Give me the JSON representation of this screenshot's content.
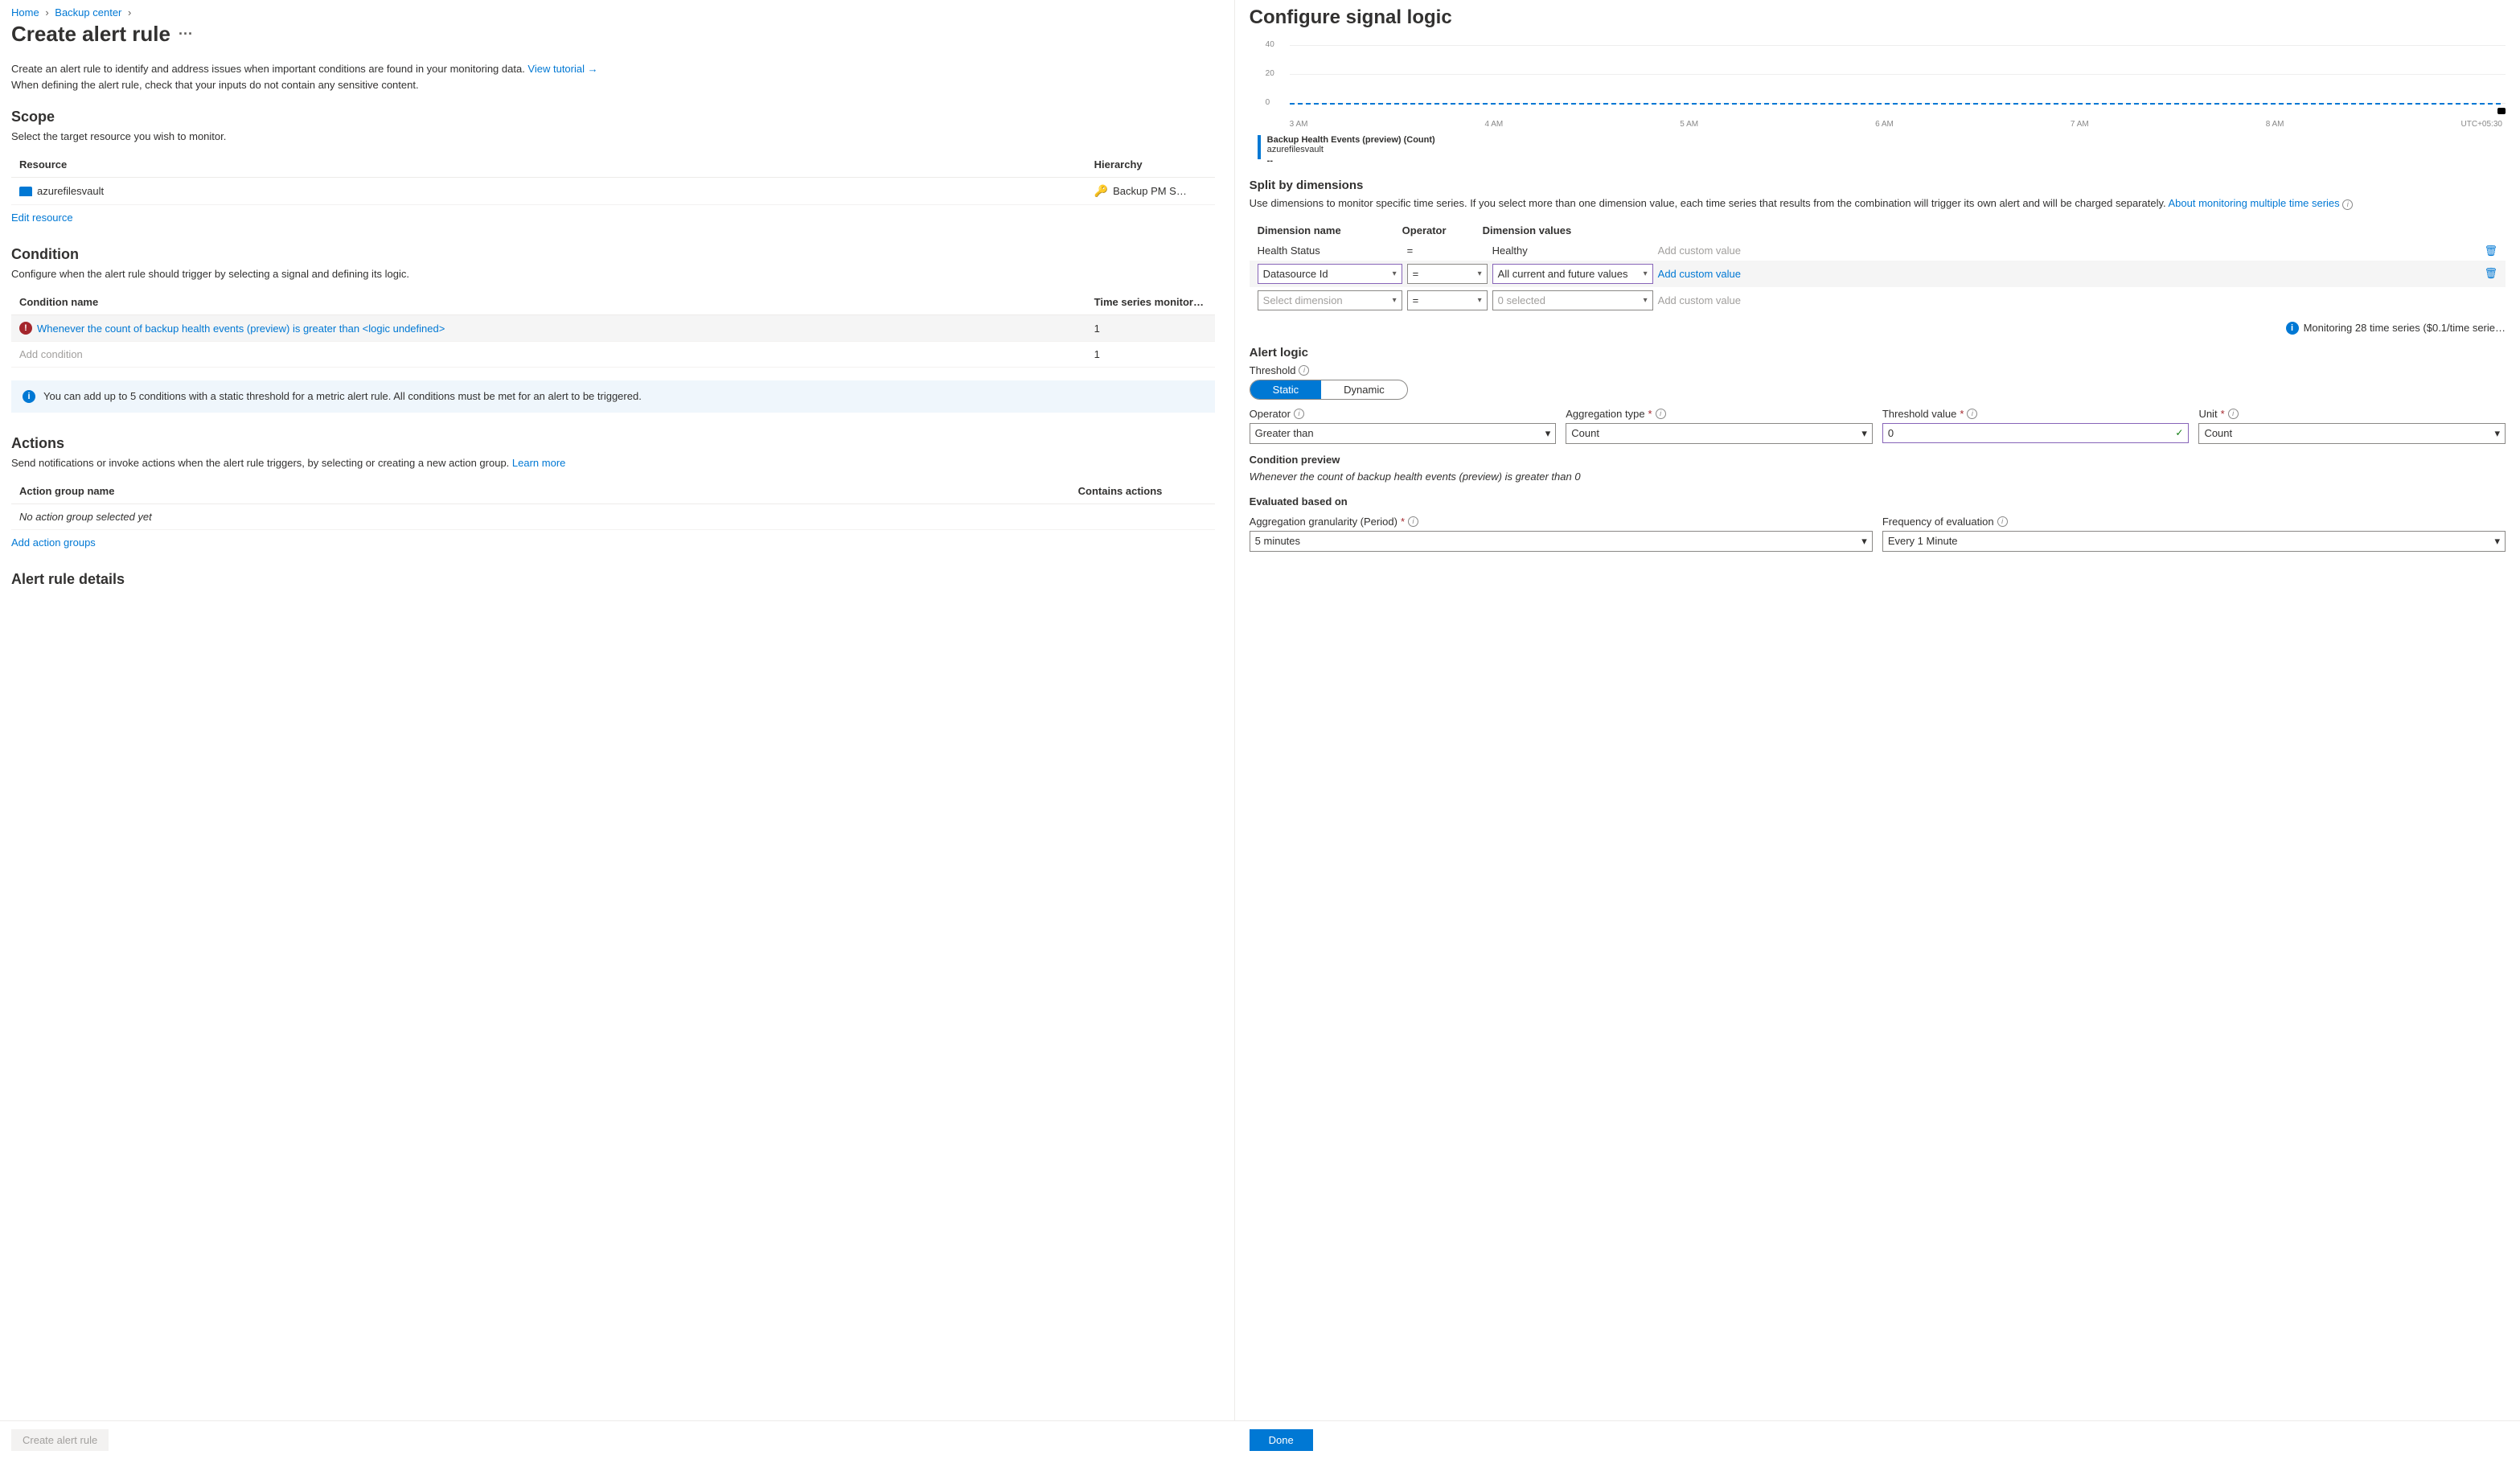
{
  "breadcrumb": {
    "home": "Home",
    "backup_center": "Backup center"
  },
  "page_title": "Create alert rule",
  "intro_text": "Create an alert rule to identify and address issues when important conditions are found in your monitoring data. ",
  "intro_link": "View tutorial →",
  "intro_text2": "When defining the alert rule, check that your inputs do not contain any sensitive content.",
  "scope": {
    "heading": "Scope",
    "desc": "Select the target resource you wish to monitor.",
    "col_resource": "Resource",
    "col_hierarchy": "Hierarchy",
    "resource_name": "azurefilesvault",
    "hierarchy_text": "Backup PM S…",
    "edit_link": "Edit resource"
  },
  "condition": {
    "heading": "Condition",
    "desc": "Configure when the alert rule should trigger by selecting a signal and defining its logic.",
    "col_name": "Condition name",
    "col_ts": "Time series monitor…",
    "row_text": "Whenever the count of backup health events (preview) is greater than <logic undefined>",
    "row_ts": "1",
    "add_text": "Add condition",
    "add_ts": "1",
    "banner": "You can add up to 5 conditions with a static threshold for a metric alert rule. All conditions must be met for an alert to be triggered."
  },
  "actions": {
    "heading": "Actions",
    "desc_pre": "Send notifications or invoke actions when the alert rule triggers, by selecting or creating a new action group. ",
    "desc_link": "Learn more",
    "col_name": "Action group name",
    "col_contains": "Contains actions",
    "empty": "No action group selected yet",
    "add_link": "Add action groups"
  },
  "details_heading": "Alert rule details",
  "create_btn": "Create alert rule",
  "right": {
    "title": "Configure signal logic",
    "chart_data": {
      "type": "line",
      "y_ticks": [
        0,
        20,
        40
      ],
      "x_ticks": [
        "3 AM",
        "4 AM",
        "5 AM",
        "6 AM",
        "7 AM",
        "8 AM",
        "UTC+05:30"
      ],
      "series": [
        {
          "name": "Backup Health Events (preview) (Count)",
          "value_constant": 0
        }
      ]
    },
    "legend_title": "Backup Health Events (preview) (Count)",
    "legend_sub": "azurefilesvault",
    "legend_val": "--",
    "split_heading": "Split by dimensions",
    "split_desc": "Use dimensions to monitor specific time series. If you select more than one dimension value, each time series that results from the combination will trigger its own alert and will be charged separately. ",
    "split_link": "About monitoring multiple time series",
    "dim_cols": {
      "name": "Dimension name",
      "op": "Operator",
      "val": "Dimension values"
    },
    "dim_rows": [
      {
        "name": "Health Status",
        "op": "=",
        "val": "Healthy",
        "custom": "Add custom value",
        "plain": true
      },
      {
        "name": "Datasource Id",
        "op": "=",
        "val": "All current and future values",
        "custom": "Add custom value",
        "purple": true,
        "custom_link": true
      },
      {
        "name": "Select dimension",
        "op": "=",
        "val": "0 selected",
        "custom": "Add custom value",
        "muted": true
      }
    ],
    "monitoring_note": "Monitoring 28 time series ($0.1/time serie…",
    "alert_logic_heading": "Alert logic",
    "threshold_label": "Threshold",
    "threshold_opts": {
      "static": "Static",
      "dynamic": "Dynamic"
    },
    "operator_label": "Operator",
    "operator_val": "Greater than",
    "agg_label": "Aggregation type",
    "agg_val": "Count",
    "thresh_val_label": "Threshold value",
    "thresh_val": "0",
    "unit_label": "Unit",
    "unit_val": "Count",
    "preview_label": "Condition preview",
    "preview_text": "Whenever the count of backup health events (preview) is greater than 0",
    "eval_heading": "Evaluated based on",
    "gran_label": "Aggregation granularity (Period)",
    "gran_val": "5 minutes",
    "freq_label": "Frequency of evaluation",
    "freq_val": "Every 1 Minute",
    "done_btn": "Done"
  }
}
